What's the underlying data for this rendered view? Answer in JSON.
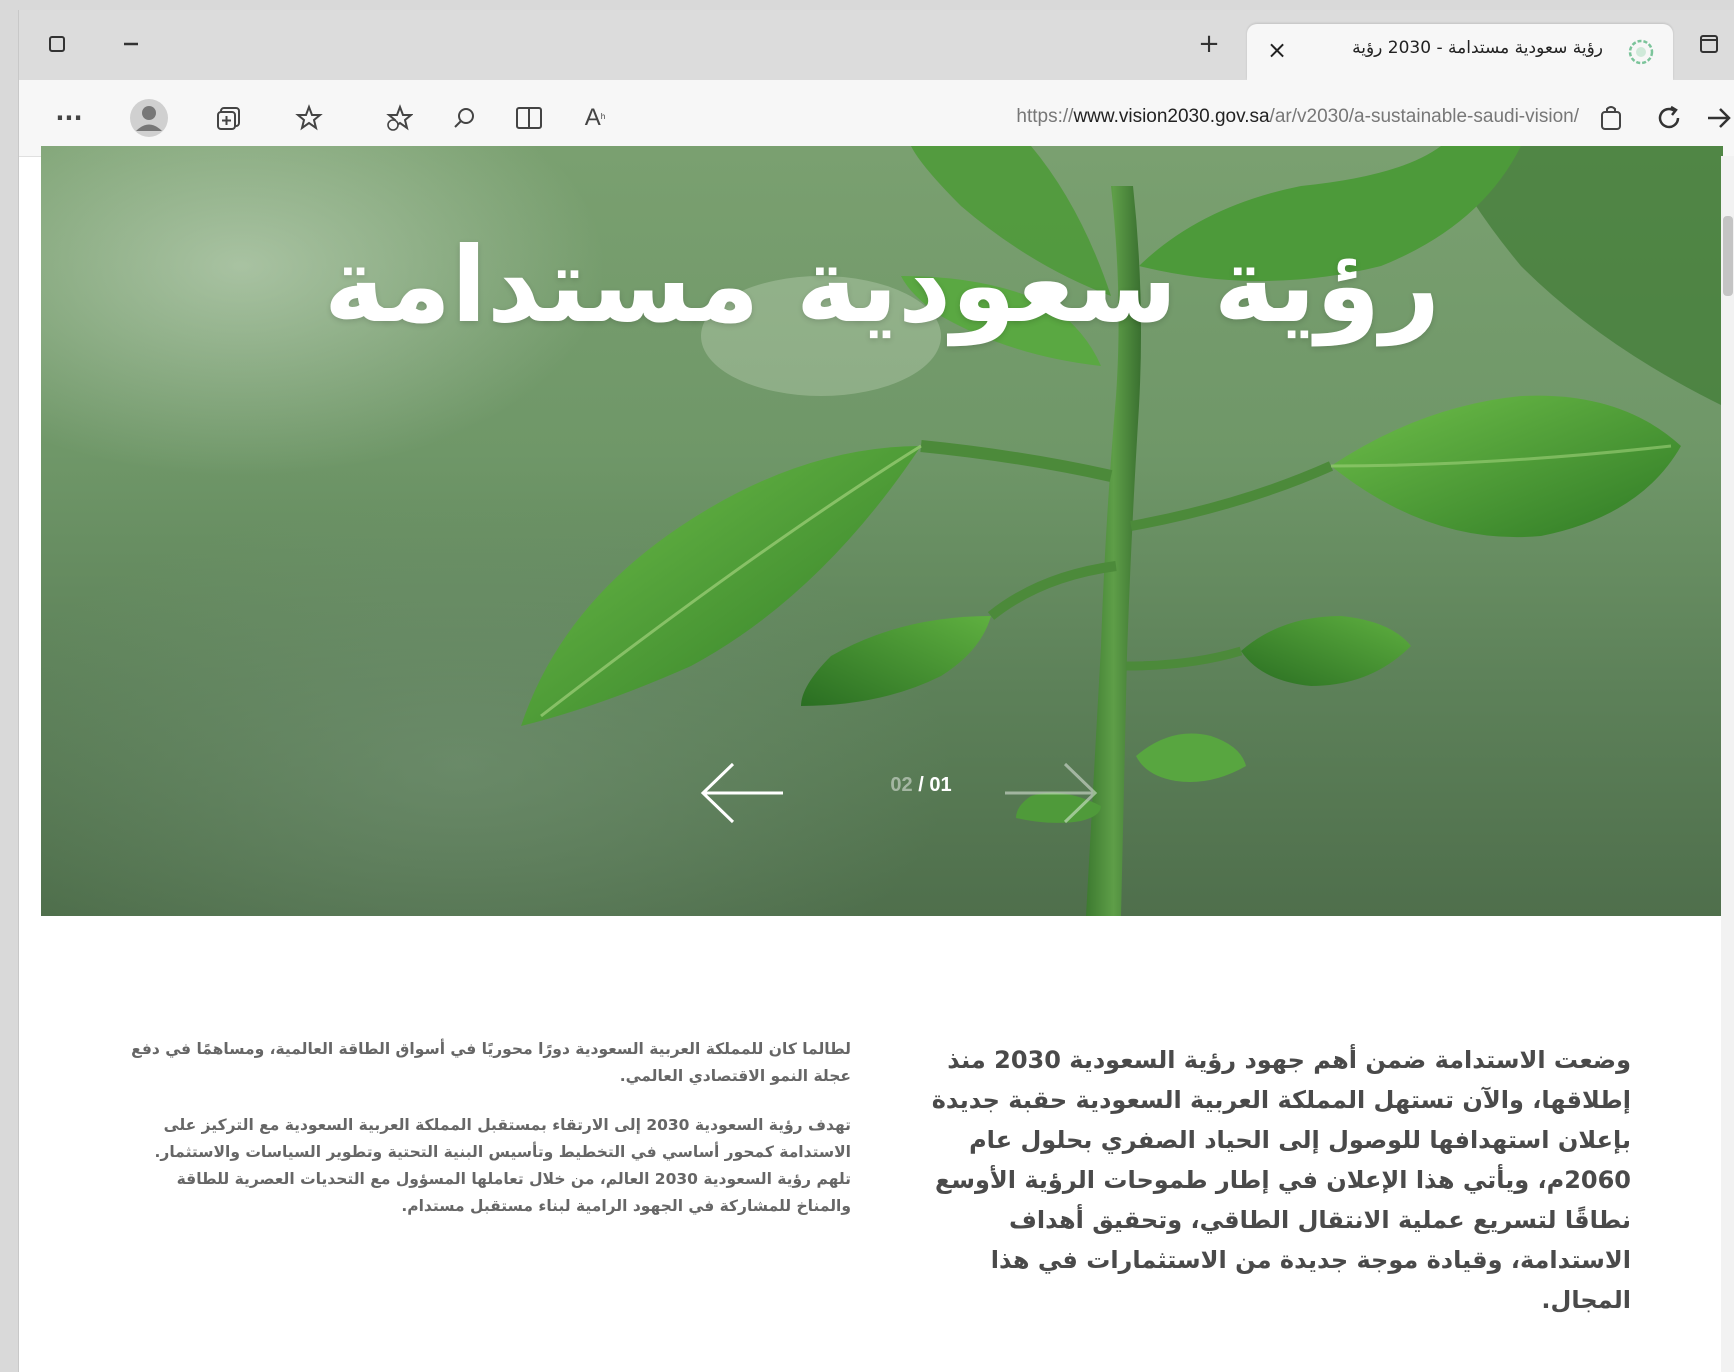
{
  "browser": {
    "tab_title": "رؤية سعودية مستدامة - 2030 رؤية",
    "new_tab_label": "+",
    "close_tab_label": "×",
    "url_prefix": "https://",
    "url_domain": "www.vision2030.gov.sa",
    "url_path": "/ar/v2030/a-sustainable-saudi-vision/",
    "menu_label": "···",
    "icons": [
      "tab-actions-icon",
      "minimize-icon",
      "new-tab-icon",
      "close-icon",
      "favicon-icon",
      "window-restore-icon",
      "more-icon",
      "profile-icon",
      "collections-icon",
      "favorites-icon",
      "add-favorite-icon",
      "find-icon",
      "immersive-reader-icon",
      "read-aloud-icon",
      "extensions-icon",
      "refresh-icon",
      "forward-icon"
    ]
  },
  "hero": {
    "title": "رؤية سعودية مستدامة",
    "counter_current": "01",
    "counter_separator": " / ",
    "counter_total": "02"
  },
  "content": {
    "right_paragraph": "وضعت الاستدامة ضمن أهم جهود رؤية السعودية 2030 منذ إطلاقها، والآن تستهل المملكة العربية السعودية حقبة جديدة بإعلان استهدافها للوصول إلى الحياد الصفري بحلول عام 2060م، ويأتي هذا الإعلان في إطار طموحات الرؤية الأوسع نطاقًا لتسريع عملية الانتقال الطاقي، وتحقيق أهداف الاستدامة، وقيادة موجة جديدة من الاستثمارات في هذا المجال.",
    "left_paragraph_1": "لطالما كان للمملكة العربية السعودية دورًا محوريًا في أسواق الطاقة العالمية، ومساهمًا في دفع عجلة النمو الاقتصادي العالمي.",
    "left_paragraph_2": "تهدف رؤية السعودية 2030 إلى الارتقاء بمستقبل المملكة العربية السعودية مع التركيز على الاستدامة كمحور أساسي في التخطيط وتأسيس البنية التحتية وتطوير السياسات والاستثمار. تلهم رؤية السعودية 2030 العالم، من خلال تعاملها المسؤول مع التحديات العصرية للطاقة والمناخ للمشاركة في الجهود الرامية لبناء مستقبل مستدام."
  },
  "colors": {
    "hero_green": "#6f9768",
    "leaf_green": "#4f9a3a",
    "text_gray": "#4a4a4a"
  }
}
